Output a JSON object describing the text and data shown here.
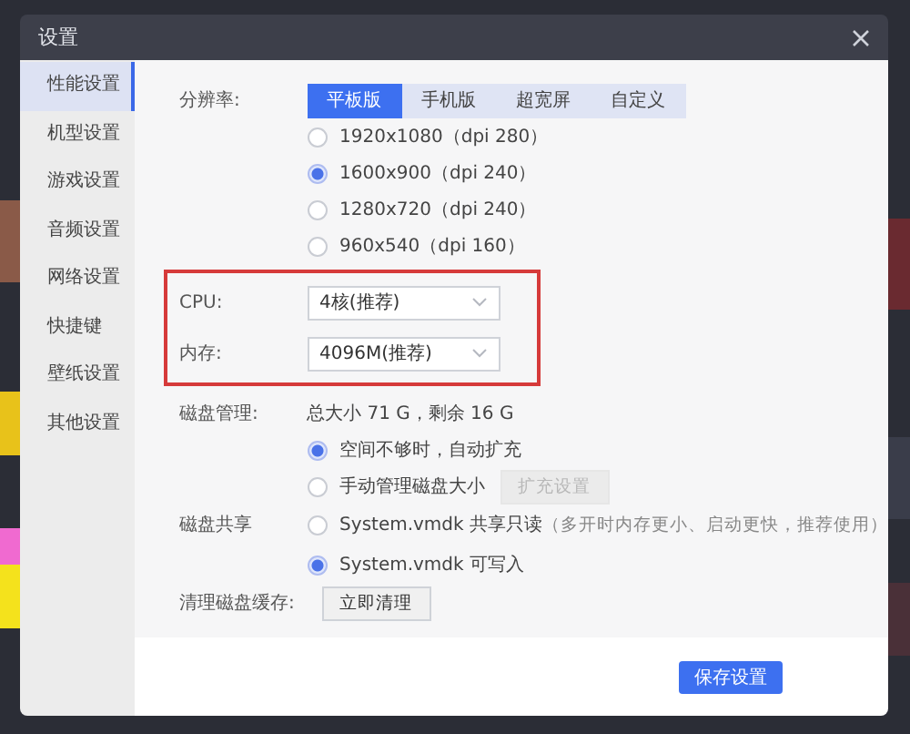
{
  "window": {
    "title": "设置"
  },
  "sidebar": {
    "items": [
      {
        "label": "性能设置",
        "selected": true
      },
      {
        "label": "机型设置",
        "selected": false
      },
      {
        "label": "游戏设置",
        "selected": false
      },
      {
        "label": "音频设置",
        "selected": false
      },
      {
        "label": "网络设置",
        "selected": false
      },
      {
        "label": "快捷键",
        "selected": false
      },
      {
        "label": "壁纸设置",
        "selected": false
      },
      {
        "label": "其他设置",
        "selected": false
      }
    ]
  },
  "resolution": {
    "label": "分辨率:",
    "tabs": [
      {
        "label": "平板版",
        "selected": true
      },
      {
        "label": "手机版",
        "selected": false
      },
      {
        "label": "超宽屏",
        "selected": false
      },
      {
        "label": "自定义",
        "selected": false
      }
    ],
    "options": [
      {
        "label": "1920x1080（dpi 280）",
        "selected": false
      },
      {
        "label": "1600x900（dpi 240）",
        "selected": true
      },
      {
        "label": "1280x720（dpi 240）",
        "selected": false
      },
      {
        "label": "960x540（dpi 160）",
        "selected": false
      }
    ]
  },
  "cpu": {
    "label": "CPU:",
    "value": "4核(推荐)"
  },
  "memory": {
    "label": "内存:",
    "value": "4096M(推荐)"
  },
  "disk": {
    "label": "磁盘管理:",
    "summary": "总大小 71 G，剩余 16 G",
    "options": [
      {
        "label": "空间不够时，自动扩充",
        "selected": true
      },
      {
        "label": "手动管理磁盘大小",
        "selected": false,
        "button": {
          "label": "扩充设置",
          "disabled": true
        }
      }
    ]
  },
  "share": {
    "label": "磁盘共享",
    "options": [
      {
        "label": "System.vmdk 共享只读",
        "note": "（多开时内存更小、启动更快，推荐使用）",
        "selected": false
      },
      {
        "label": "System.vmdk 可写入",
        "selected": true
      }
    ]
  },
  "cache": {
    "label": "清理磁盘缓存:",
    "button": "立即清理"
  },
  "footer": {
    "save": "保存设置"
  }
}
